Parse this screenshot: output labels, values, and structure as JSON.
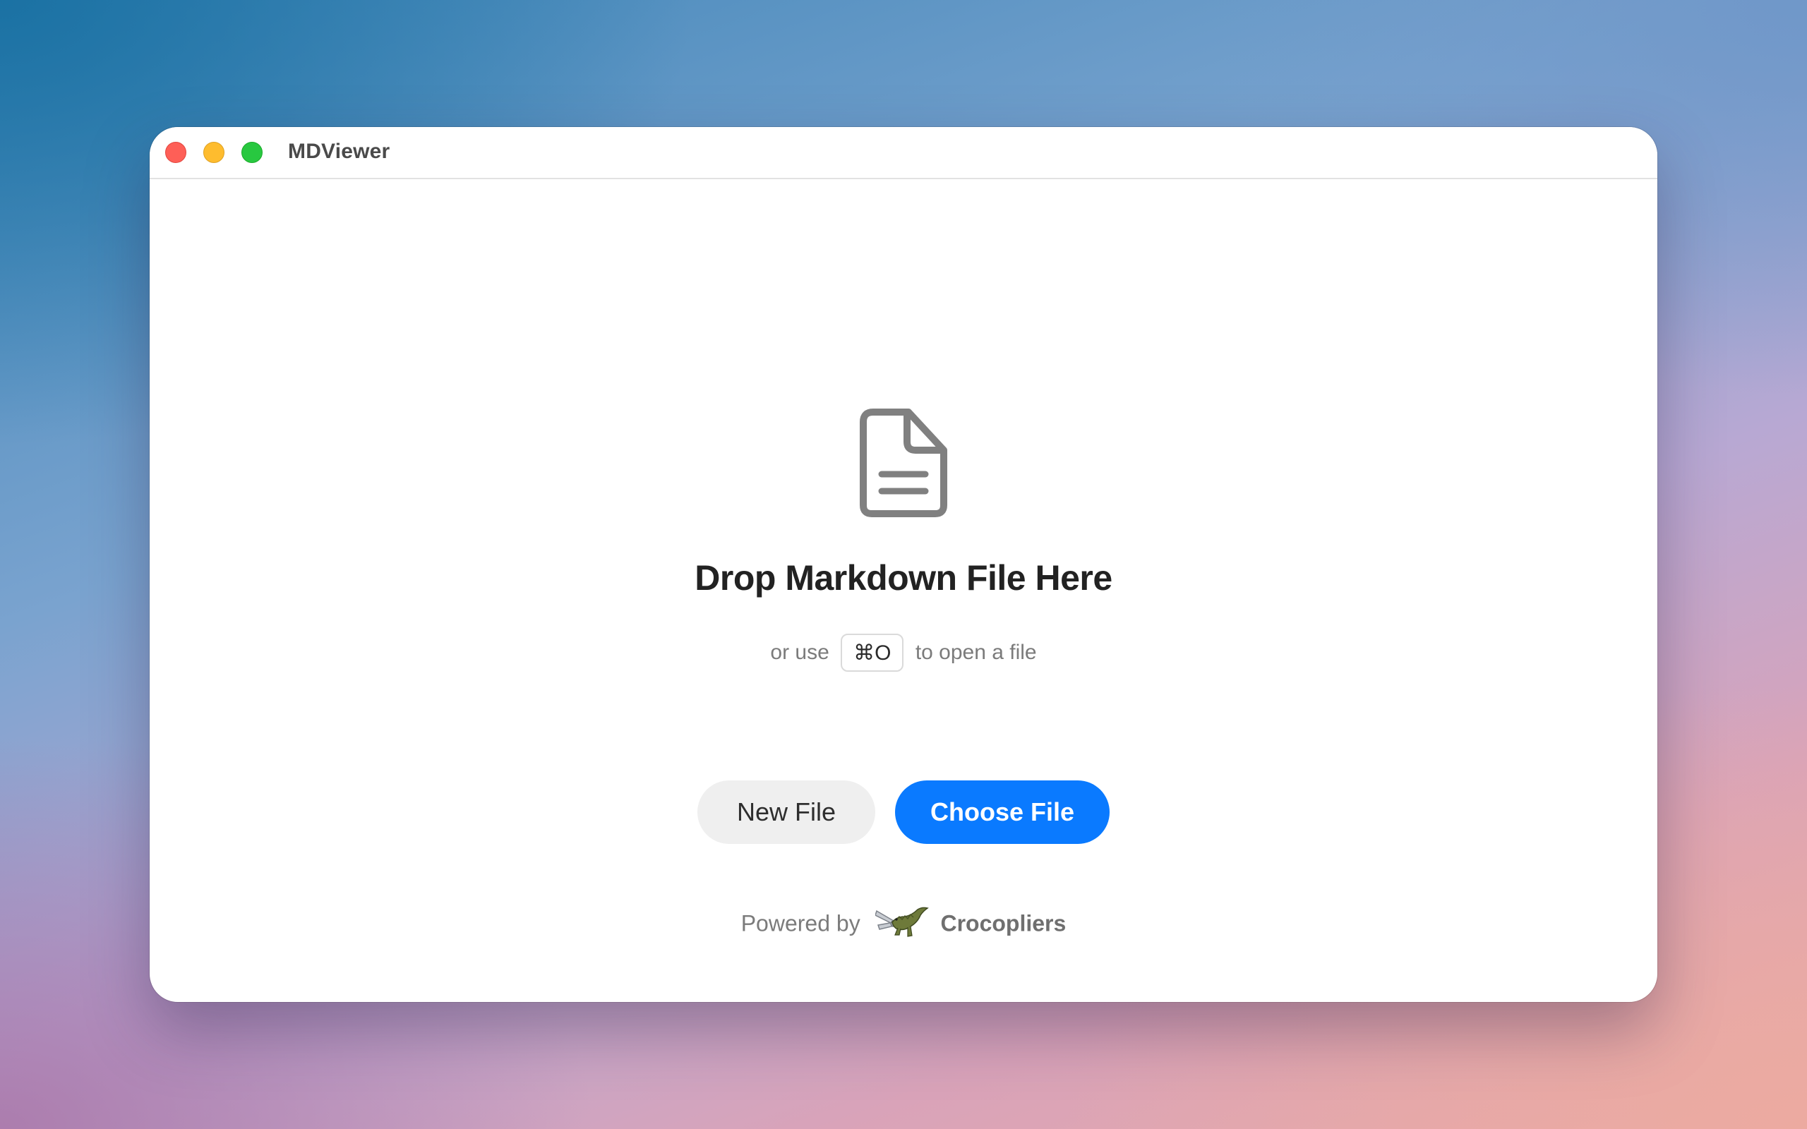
{
  "window": {
    "title": "MDViewer"
  },
  "empty_state": {
    "icon": "document-icon",
    "headline": "Drop Markdown File Here",
    "hint_prefix": "or use",
    "shortcut": "⌘O",
    "hint_suffix": "to open a file"
  },
  "buttons": {
    "new_file": "New File",
    "choose_file": "Choose File"
  },
  "footer": {
    "powered_by": "Powered by",
    "brand_icon": "crocodile-pliers-icon",
    "brand": "Crocopliers"
  },
  "colors": {
    "primary": "#0a7aff",
    "secondary_bg": "#efefef",
    "close": "#fe5f57",
    "minimize": "#febc2e",
    "maximize": "#28c840"
  }
}
